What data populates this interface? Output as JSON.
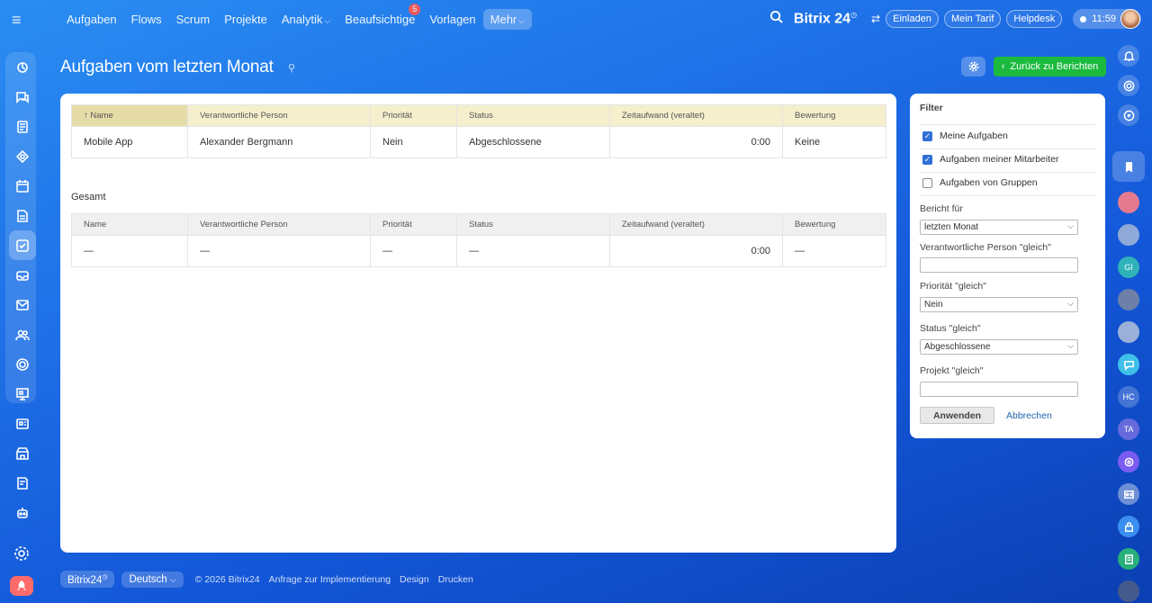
{
  "top_nav": {
    "items": [
      {
        "label": "Aufgaben"
      },
      {
        "label": "Flows"
      },
      {
        "label": "Scrum"
      },
      {
        "label": "Projekte"
      },
      {
        "label": "Analytik",
        "dropdown": true
      },
      {
        "label": "Beaufsichtige",
        "badge": "5"
      },
      {
        "label": "Vorlagen"
      },
      {
        "label": "Mehr",
        "dropdown": true,
        "active": true
      }
    ]
  },
  "header": {
    "logo": "Bitrix 24",
    "invite_label": "Einladen",
    "tariff_label": "Mein Tarif",
    "helpdesk_label": "Helpdesk",
    "time": "11:59"
  },
  "page": {
    "title": "Aufgaben vom letzten Monat",
    "back_label": "Zurück zu Berichten"
  },
  "report": {
    "columns": [
      "Name",
      "Verantwortliche Person",
      "Priorität",
      "Status",
      "Zeitaufwand (veraltet)",
      "Bewertung"
    ],
    "sort_indicator": "↑",
    "rows": [
      {
        "name": "Mobile App",
        "person": "Alexander Bergmann",
        "priority": "Nein",
        "status": "Abgeschlossene",
        "time": "0:00",
        "rating": "Keine"
      }
    ],
    "total_label": "Gesamt",
    "total_row": {
      "name": "—",
      "person": "—",
      "priority": "—",
      "status": "—",
      "time": "0:00",
      "rating": "—"
    }
  },
  "filter": {
    "title": "Filter",
    "checkboxes": [
      {
        "label": "Meine Aufgaben",
        "checked": true
      },
      {
        "label": "Aufgaben meiner Mitarbeiter",
        "checked": true
      },
      {
        "label": "Aufgaben von Gruppen",
        "checked": false
      }
    ],
    "report_for_label": "Bericht für",
    "report_for_value": "letzten Monat",
    "responsible_label": "Verantwortliche Person \"gleich\"",
    "responsible_value": "",
    "priority_label": "Priorität \"gleich\"",
    "priority_value": "Nein",
    "status_label": "Status \"gleich\"",
    "status_value": "Abgeschlossene",
    "project_label": "Projekt \"gleich\"",
    "project_value": "",
    "apply_label": "Anwenden",
    "cancel_label": "Abbrechen"
  },
  "footer": {
    "brand": "Bitrix24",
    "language": "Deutsch",
    "copyright": "© 2026 Bitrix24",
    "links": [
      "Anfrage zur Implementierung",
      "Design",
      "Drucken"
    ]
  },
  "right_sidebar": {
    "initials": [
      "GI",
      "HC",
      "TA"
    ]
  },
  "colors": {
    "accent_green": "#1bba3e",
    "link_blue": "#2067b0",
    "badge_red": "#ff5752",
    "table_header_yellow": "#f5efcd"
  }
}
